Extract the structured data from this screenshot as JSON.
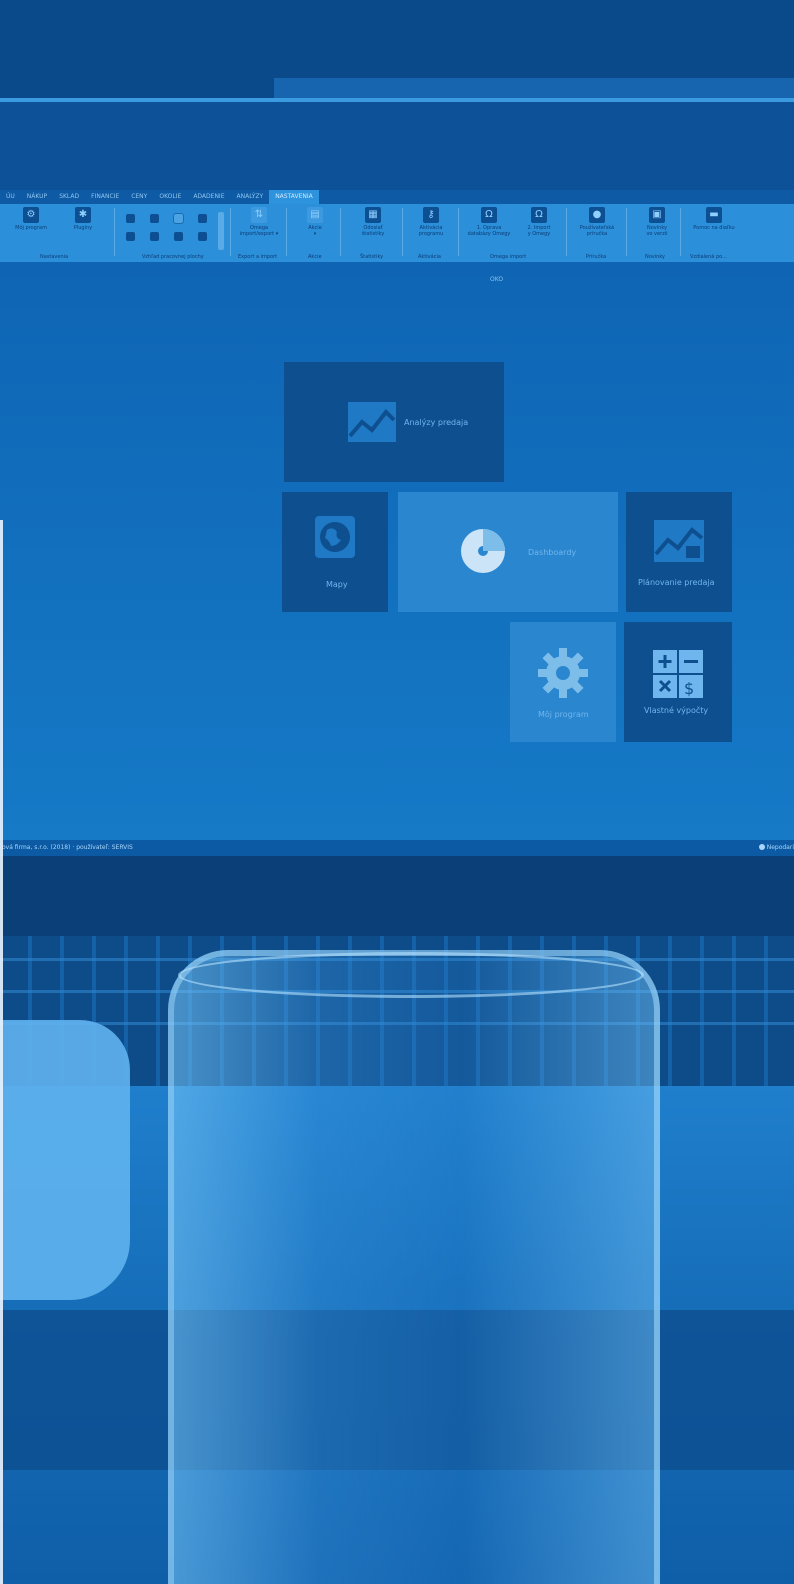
{
  "app": {
    "title": "OKO"
  },
  "menu": {
    "tabs": [
      {
        "label": "ÚU"
      },
      {
        "label": "NÁKUP"
      },
      {
        "label": "SKLAD"
      },
      {
        "label": "FINANCIE"
      },
      {
        "label": "CENY"
      },
      {
        "label": "OKOLIE"
      },
      {
        "label": "ADADENIE"
      },
      {
        "label": "ANALÝZY"
      },
      {
        "label": "NASTAVENIA",
        "active": true
      }
    ]
  },
  "ribbon": {
    "buttons": [
      {
        "label": "Môj program",
        "icon": "gear-icon"
      },
      {
        "label": "Pluginy",
        "icon": "puzzle-icon"
      },
      {
        "label": "Omega\nimport/export ▾",
        "icon": "transfer-icon"
      },
      {
        "label": "Akcie\n▾",
        "icon": "actions-icon"
      },
      {
        "label": "Odoslať\nštatistiky",
        "icon": "statistics-icon"
      },
      {
        "label": "Aktivácia\nprogramu",
        "icon": "key-icon"
      },
      {
        "label": "1. Oprava\ndatabázy Omegy",
        "icon": "omega-icon"
      },
      {
        "label": "2. Import\ny Omegy",
        "icon": "omega-icon"
      },
      {
        "label": "Používateľská\npríručka",
        "icon": "bulb-icon"
      },
      {
        "label": "Novinky\nvo verzii",
        "icon": "news-icon"
      },
      {
        "label": "Pomoc na diaľku",
        "icon": "remote-icon"
      }
    ],
    "groups": [
      {
        "label": "Nastavenia"
      },
      {
        "label": "Vzhľad pracovnej plochy"
      },
      {
        "label": "Export a import"
      },
      {
        "label": "Akcie"
      },
      {
        "label": "Štatistiky"
      },
      {
        "label": "Aktivácia"
      },
      {
        "label": "Omega import"
      },
      {
        "label": "Príručka"
      },
      {
        "label": "Novinky"
      },
      {
        "label": "Vzdialená po..."
      }
    ]
  },
  "tiles": {
    "analyzy": {
      "label": "Analýzy predaja",
      "icon": "chart-icon"
    },
    "mapy": {
      "label": "Mapy",
      "icon": "globe-icon"
    },
    "dashboard": {
      "label": "Dashboardy",
      "icon": "disc-icon"
    },
    "planovanie": {
      "label": "Plánovanie predaja",
      "icon": "chart-calendar-icon"
    },
    "mojprogram": {
      "label": "Môj program",
      "icon": "gear-icon"
    },
    "vypocty": {
      "label": "Vlastné výpočty",
      "icon": "calculator-icon"
    }
  },
  "status": {
    "left": "ová firma, s.r.o. (2018) · používateľ: SERVIS",
    "right": "Nepodari"
  }
}
